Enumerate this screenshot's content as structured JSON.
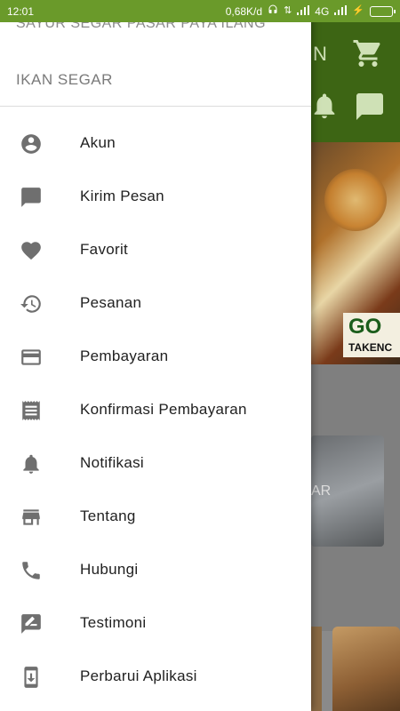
{
  "status_bar": {
    "time": "12:01",
    "net_speed": "0,68K/d",
    "network": "4G"
  },
  "background_app": {
    "title_fragment": "N",
    "fish_label_fragment": "AR",
    "banner_go": "GO",
    "banner_take": "TAKENC",
    "icons": [
      "cart-icon",
      "bell-icon",
      "message-icon"
    ],
    "app_bar_color": "#3d6514"
  },
  "drawer": {
    "subtitle": "SAYUR SEGAR PASAR PAYA ILANG",
    "title": "IKAN SEGAR",
    "items": [
      {
        "label": "Akun",
        "icon": "account-icon"
      },
      {
        "label": "Kirim Pesan",
        "icon": "message-icon"
      },
      {
        "label": "Favorit",
        "icon": "heart-icon"
      },
      {
        "label": "Pesanan",
        "icon": "history-icon"
      },
      {
        "label": "Pembayaran",
        "icon": "credit-card-icon"
      },
      {
        "label": "Konfirmasi Pembayaran",
        "icon": "receipt-icon"
      },
      {
        "label": "Notifikasi",
        "icon": "bell-icon"
      },
      {
        "label": "Tentang",
        "icon": "store-icon"
      },
      {
        "label": "Hubungi",
        "icon": "phone-icon"
      },
      {
        "label": "Testimoni",
        "icon": "testimonial-icon"
      },
      {
        "label": "Perbarui Aplikasi",
        "icon": "update-app-icon"
      }
    ],
    "icon_color": "#6f6f6f"
  }
}
